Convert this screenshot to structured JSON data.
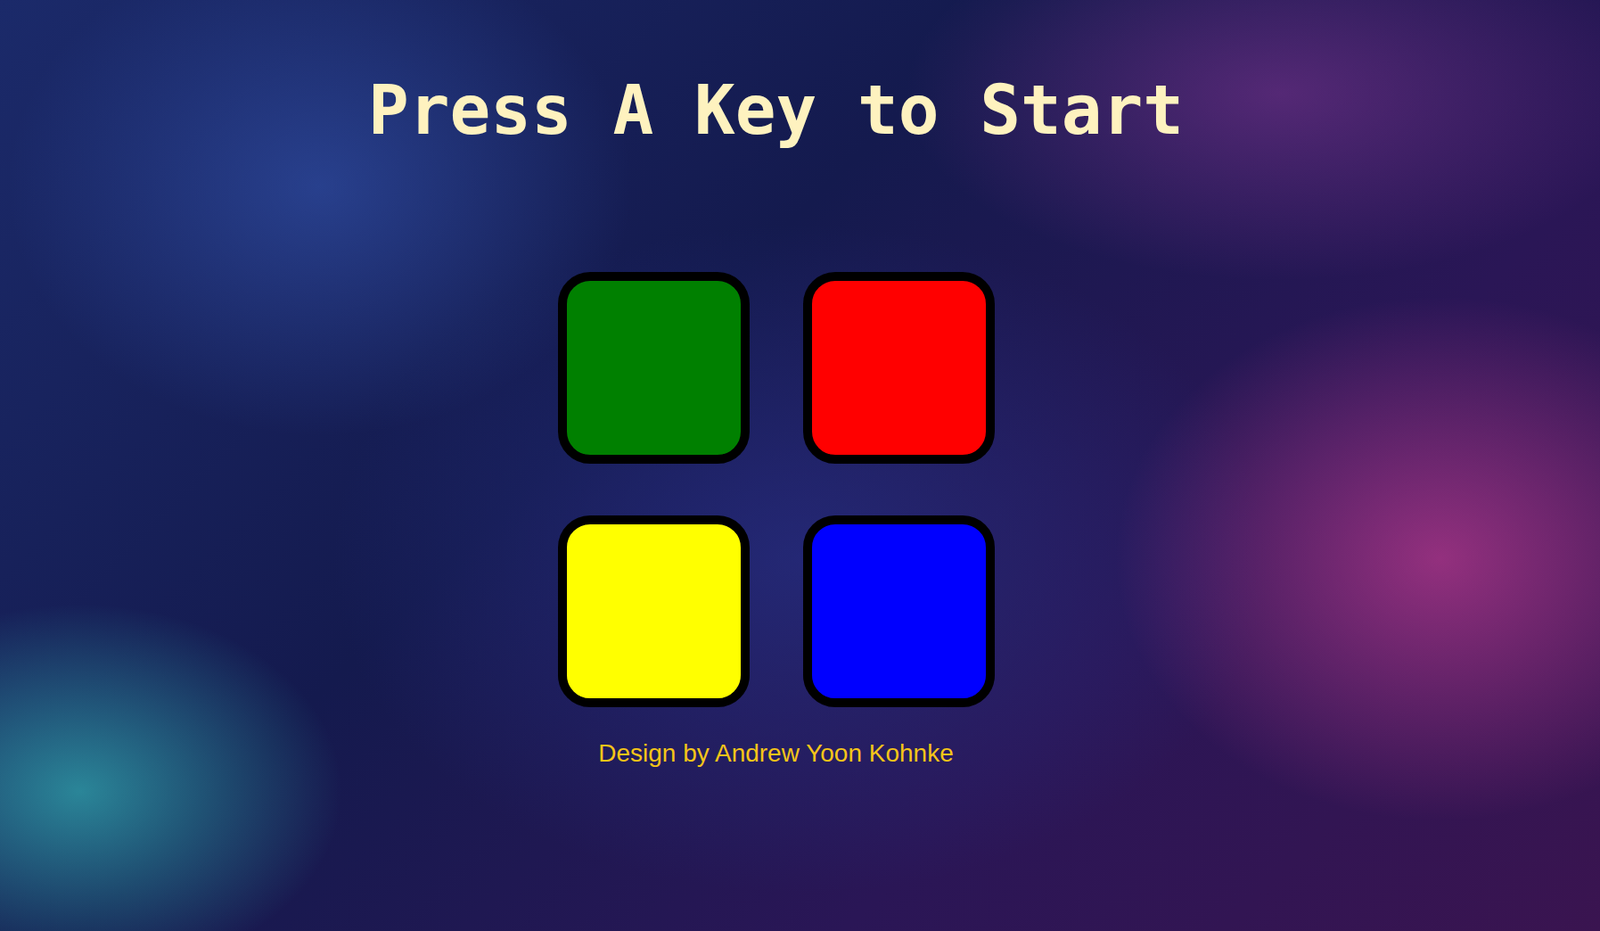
{
  "title": "Press A Key to Start",
  "pads": [
    {
      "color": "#008000"
    },
    {
      "color": "#ff0000"
    },
    {
      "color": "#ffff00"
    },
    {
      "color": "#0000ff"
    }
  ],
  "footer": "Design by Andrew Yoon Kohnke"
}
